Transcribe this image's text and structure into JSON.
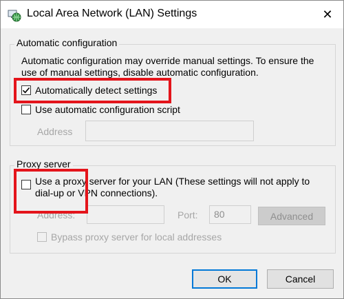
{
  "window": {
    "title": "Local Area Network (LAN) Settings",
    "icon": "globe-network-icon",
    "close_glyph": "✕"
  },
  "auto_config": {
    "legend": "Automatic configuration",
    "description_line1": "Automatic configuration may override manual settings.  To ensure the",
    "description_line2": "use of manual settings, disable automatic configuration.",
    "detect_label": "Automatically detect settings",
    "detect_checked": true,
    "script_label": "Use automatic configuration script",
    "script_checked": false,
    "address_label": "Address",
    "address_value": ""
  },
  "proxy": {
    "legend": "Proxy server",
    "use_proxy_line1": "Use a proxy server for your LAN (These settings will not apply to",
    "use_proxy_line2": "dial-up or VPN connections).",
    "use_proxy_checked": false,
    "address_label": "Address:",
    "address_value": "",
    "port_label": "Port:",
    "port_value": "80",
    "advanced_label": "Advanced",
    "bypass_label": "Bypass proxy server for local addresses",
    "bypass_checked": false
  },
  "footer": {
    "ok_label": "OK",
    "cancel_label": "Cancel"
  },
  "colors": {
    "highlight": "#e4141b",
    "ok_border": "#0078d7"
  }
}
